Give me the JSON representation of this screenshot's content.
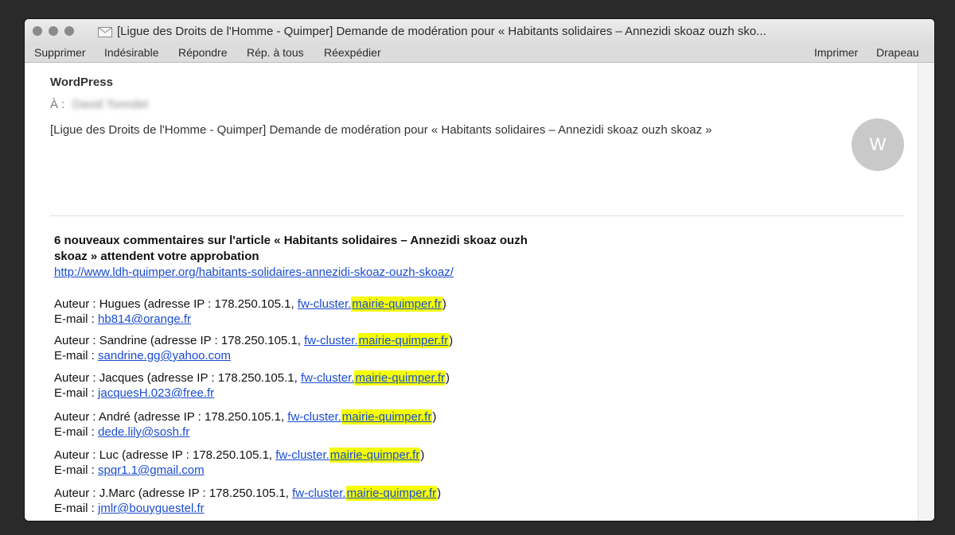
{
  "window": {
    "title": "[Ligue des Droits de l'Homme - Quimper] Demande de modération pour « Habitants solidaires – Annezidi skoaz ouzh sko..."
  },
  "toolbar": {
    "delete": "Supprimer",
    "junk": "Indésirable",
    "reply": "Répondre",
    "reply_all": "Rép. à tous",
    "forward": "Réexpédier",
    "print": "Imprimer",
    "flag": "Drapeau"
  },
  "header": {
    "sender": "WordPress",
    "to_label": "À :",
    "to_value": "David Tonndel",
    "subject": "[Ligue des Droits de l'Homme - Quimper] Demande de modération pour « Habitants solidaires – Annezidi skoaz ouzh skoaz »",
    "avatar_letter": "W"
  },
  "message": {
    "title": "6 nouveaux commentaires sur l'article « Habitants solidaires – Annezidi skoaz ouzh skoaz » attendent votre approbation",
    "url": "http://www.ldh-quimper.org/habitants-solidaires-annezidi-skoaz-ouzh-skoaz/",
    "author_label": "Auteur :",
    "ip_label": "(adresse IP :",
    "email_label": "E-mail :",
    "comments": [
      {
        "author": "Hugues",
        "ip": "178.250.105.1,",
        "host_prefix": "fw-cluster.",
        "host_domain": "mairie-quimper.fr",
        "close": ")",
        "email": "hb814@orange.fr"
      },
      {
        "author": "Sandrine",
        "ip": "178.250.105.1,",
        "host_prefix": "fw-cluster.",
        "host_domain": "mairie-quimper.fr",
        "close": ")",
        "email": "sandrine.gg@yahoo.com"
      },
      {
        "author": "Jacques",
        "ip": "178.250.105.1,",
        "host_prefix": "fw-cluster.",
        "host_domain": "mairie-quimper.fr",
        "close": ")",
        "email": "jacquesH.023@free.fr"
      },
      {
        "author": "André",
        "ip": "178.250.105.1,",
        "host_prefix": "fw-cluster.",
        "host_domain": "mairie-quimper.fr",
        "close": ")",
        "email": "dede.lily@sosh.fr"
      },
      {
        "author": "Luc",
        "ip": "178.250.105.1,",
        "host_prefix": "fw-cluster.",
        "host_domain": "mairie-quimper.fr",
        "close": ")",
        "email": "spqr1.1@gmail.com"
      },
      {
        "author": "J.Marc",
        "ip": "178.250.105.1,",
        "host_prefix": "fw-cluster.",
        "host_domain": "mairie-quimper.fr",
        "close": ")",
        "email": "jmlr@bouyguestel.fr"
      }
    ]
  },
  "colors": {
    "highlight": "#f5ff00",
    "link": "#1a4ccf"
  }
}
